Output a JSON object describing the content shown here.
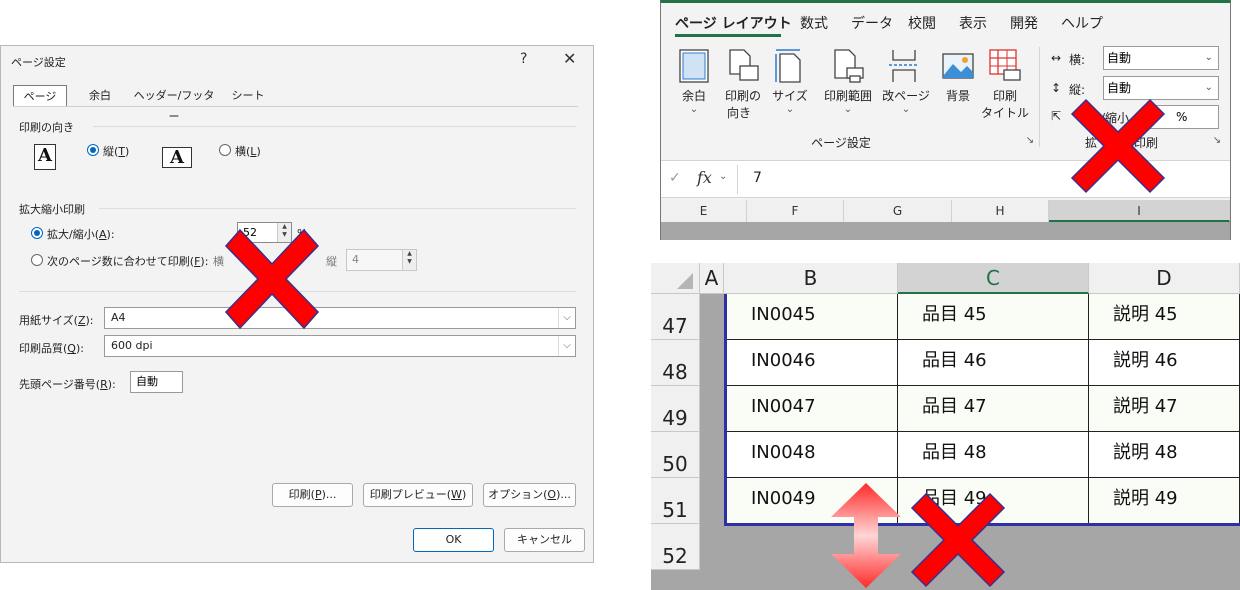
{
  "dialog": {
    "title": "ページ設定",
    "help": "?",
    "close": "✕",
    "tabs": [
      "ページ",
      "余白",
      "ヘッダー/フッター",
      "シート"
    ],
    "orientation": {
      "section": "印刷の向き",
      "portrait_label": "縦",
      "portrait_key": "T",
      "landscape_label": "横",
      "landscape_key": "L",
      "icon_letter": "A"
    },
    "scaling": {
      "section": "拡大縮小印刷",
      "adjust_label": "拡大/縮小",
      "adjust_key": "A",
      "adjust_value": "52",
      "percent": "%",
      "fit_label": "次のページ数に合わせて印刷",
      "fit_key": "F",
      "wide_label": "横",
      "tall_label": "縦",
      "tall_value": "4"
    },
    "paper_size_label": "用紙サイズ",
    "paper_size_key": "Z",
    "paper_size_value": "A4",
    "quality_label": "印刷品質",
    "quality_key": "Q",
    "quality_value": "600 dpi",
    "first_page_label": "先頭ページ番号",
    "first_page_key": "R",
    "first_page_value": "自動",
    "print_btn": "印刷(",
    "print_btn_key": "P",
    "print_btn_end": ")...",
    "preview_btn": "印刷プレビュー(",
    "preview_btn_key": "W",
    "preview_btn_end": ")",
    "options_btn": "オプション(",
    "options_btn_key": "O",
    "options_btn_end": ")...",
    "ok": "OK",
    "cancel": "キャンセル"
  },
  "ribbon": {
    "tabs": [
      "ページ レイアウト",
      "数式",
      "データ",
      "校閲",
      "表示",
      "開発",
      "ヘルプ"
    ],
    "margins": "余白",
    "orientation_1": "印刷の",
    "orientation_2": "向き",
    "size": "サイズ",
    "print_area": "印刷範囲",
    "breaks": "改ページ",
    "background": "背景",
    "print_titles_1": "印刷",
    "print_titles_2": "タイトル",
    "group_label": "ページ設定",
    "width_label": "横:",
    "width_value": "自動",
    "height_label": "縦:",
    "height_value": "自動",
    "scale_label": "/縮小",
    "scale_value": "%",
    "scale_group": "拡",
    "scale_group_end": "印刷",
    "fx": "fx",
    "formula_value": "7",
    "columns": [
      "E",
      "F",
      "G",
      "H",
      "I"
    ]
  },
  "sheet": {
    "columns": [
      "A",
      "B",
      "C",
      "D"
    ],
    "rows": [
      {
        "num": "47",
        "b": "IN0045",
        "c": "品目 45",
        "d": "説明 45"
      },
      {
        "num": "48",
        "b": "IN0046",
        "c": "品目 46",
        "d": "説明 46"
      },
      {
        "num": "49",
        "b": "IN0047",
        "c": "品目 47",
        "d": "説明 47"
      },
      {
        "num": "50",
        "b": "IN0048",
        "c": "品目 48",
        "d": "説明 48"
      },
      {
        "num": "51",
        "b": "IN0049",
        "c": "品目 49",
        "d": "説明 49"
      },
      {
        "num": "52",
        "b": "",
        "c": "",
        "d": ""
      }
    ]
  },
  "colors": {
    "accent": "#0067c0",
    "excel_green": "#217346",
    "x_mark": "#ff0000",
    "x_outline": "#3a2f8a"
  }
}
